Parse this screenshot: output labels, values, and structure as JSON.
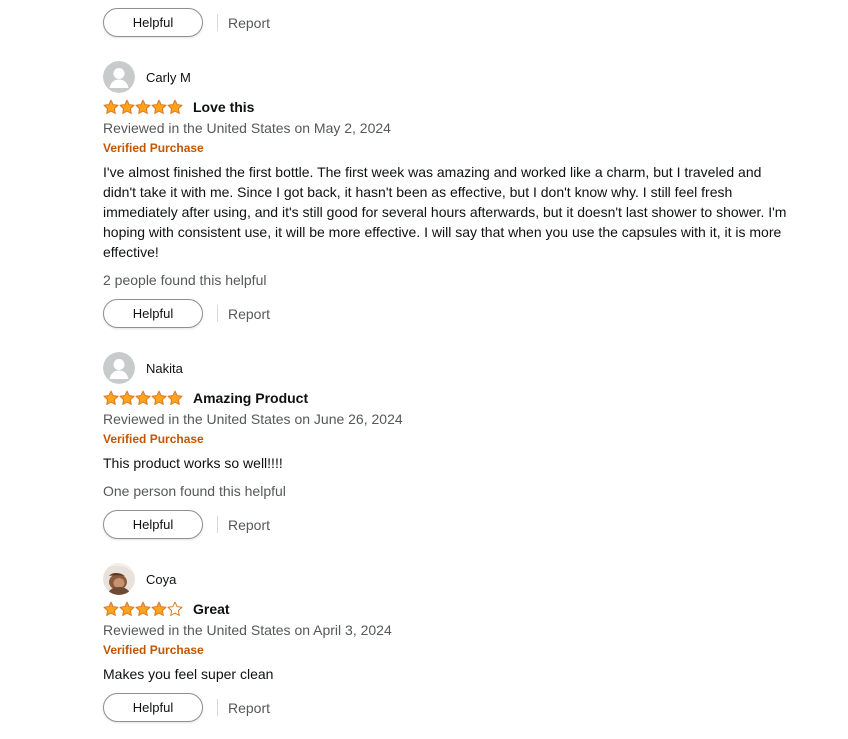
{
  "colors": {
    "star": "#ffa41c",
    "star_outline": "#de7921",
    "verified": "#c45500",
    "muted": "#565959",
    "text": "#0f1111"
  },
  "top_actions": {
    "helpful_label": "Helpful",
    "report_label": "Report"
  },
  "reviews": [
    {
      "author": "Carly M",
      "rating": 5,
      "title": "Love this",
      "date": "Reviewed in the United States on May 2, 2024",
      "verified": "Verified Purchase",
      "body": "I've almost finished the first bottle. The first week was amazing and worked like a charm, but I traveled and didn't take it with me. Since I got back, it hasn't been as effective, but I don't know why. I still feel fresh immediately after using, and it's still good for several hours afterwards, but it doesn't last shower to shower. I'm hoping with consistent use, it will be more effective. I will say that when you use the capsules with it, it is more effective!",
      "helpful_count": "2 people found this helpful",
      "helpful_label": "Helpful",
      "report_label": "Report",
      "avatar": "default-avatar-icon"
    },
    {
      "author": "Nakita",
      "rating": 5,
      "title": "Amazing Product",
      "date": "Reviewed in the United States on June 26, 2024",
      "verified": "Verified Purchase",
      "body": "This product works so well!!!!",
      "helpful_count": "One person found this helpful",
      "helpful_label": "Helpful",
      "report_label": "Report",
      "avatar": "default-avatar-icon"
    },
    {
      "author": "Coya",
      "rating": 4,
      "title": "Great",
      "date": "Reviewed in the United States on April 3, 2024",
      "verified": "Verified Purchase",
      "body": "Makes you feel super clean",
      "helpful_label": "Helpful",
      "report_label": "Report",
      "avatar": "user-photo-avatar"
    }
  ]
}
